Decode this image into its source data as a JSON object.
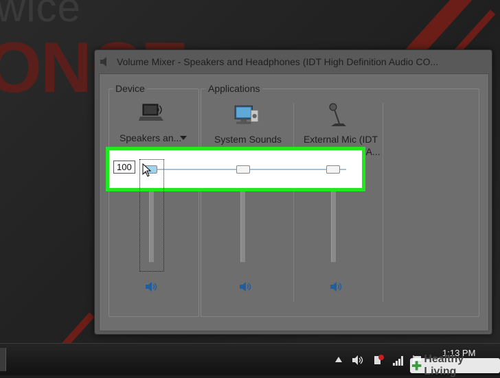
{
  "desktop": {
    "bg_text_top": "wice",
    "bg_text_big": "ONCE"
  },
  "window": {
    "title": "Volume Mixer - Speakers and Headphones (IDT High Definition Audio CO..."
  },
  "groups": {
    "device_label": "Device",
    "applications_label": "Applications"
  },
  "columns": [
    {
      "label": "Speakers an...",
      "icon": "speaker-device-icon",
      "level": 100
    },
    {
      "label": "System Sounds",
      "icon": "system-sounds-icon",
      "level": 100
    },
    {
      "label": "External Mic (IDT\nHigh Definition A...",
      "icon": "microphone-icon",
      "level": 100
    }
  ],
  "tooltip": {
    "value": "100"
  },
  "taskbar": {
    "time": "1:13 PM"
  },
  "watermark": {
    "text": "Healthy Living"
  },
  "colors": {
    "highlight_border": "#1eea1e",
    "brand_stripe": "#6b1e17"
  }
}
